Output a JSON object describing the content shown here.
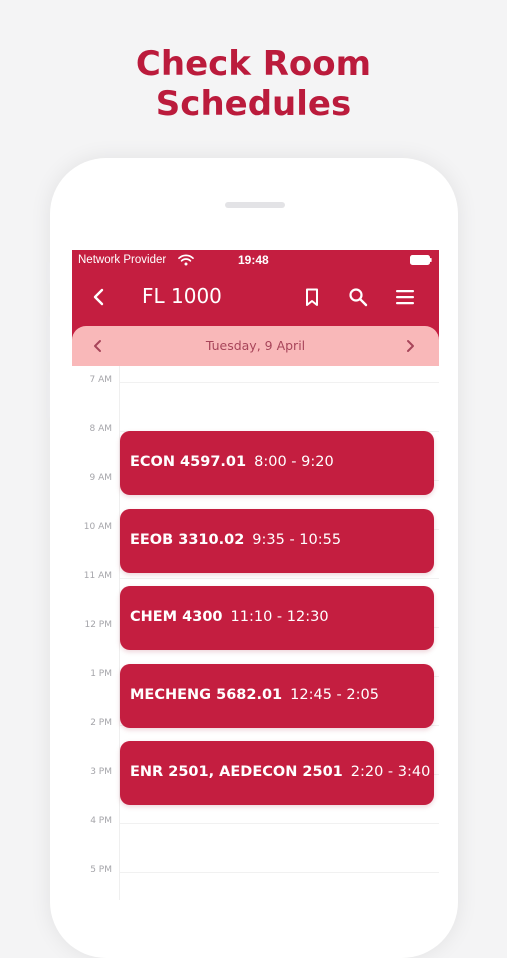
{
  "headline": {
    "line1": "Check Room",
    "line2": "Schedules"
  },
  "status_bar": {
    "carrier": "Network Provider",
    "time": "19:48",
    "icons": [
      "wifi-icon",
      "battery-icon"
    ]
  },
  "toolbar": {
    "title": "FL 1000",
    "icons": [
      "back-icon",
      "bookmark-icon",
      "search-icon",
      "menu-icon"
    ]
  },
  "date_nav": {
    "label": "Tuesday, 9 April",
    "icons": [
      "chevron-left-icon",
      "chevron-right-icon"
    ]
  },
  "hours": [
    "7 AM",
    "8 AM",
    "9 AM",
    "10 AM",
    "11 AM",
    "12 PM",
    "1 PM",
    "2 PM",
    "3 PM",
    "4 PM",
    "5 PM"
  ],
  "events": [
    {
      "course": "ECON 4597.01",
      "time": "8:00 - 9:20"
    },
    {
      "course": "EEOB 3310.02",
      "time": "9:35 - 10:55"
    },
    {
      "course": "CHEM 4300",
      "time": "11:10 - 12:30"
    },
    {
      "course": "MECHENG 5682.01",
      "time": "12:45 - 2:05"
    },
    {
      "course": "ENR 2501, AEDECON 2501",
      "time": "2:20 - 3:40"
    }
  ],
  "colors": {
    "accent": "#c41e40",
    "date_bar": "#f9b8b9",
    "date_text": "#a8455a",
    "headline": "#bb1b3c",
    "background": "#f4f4f5"
  }
}
